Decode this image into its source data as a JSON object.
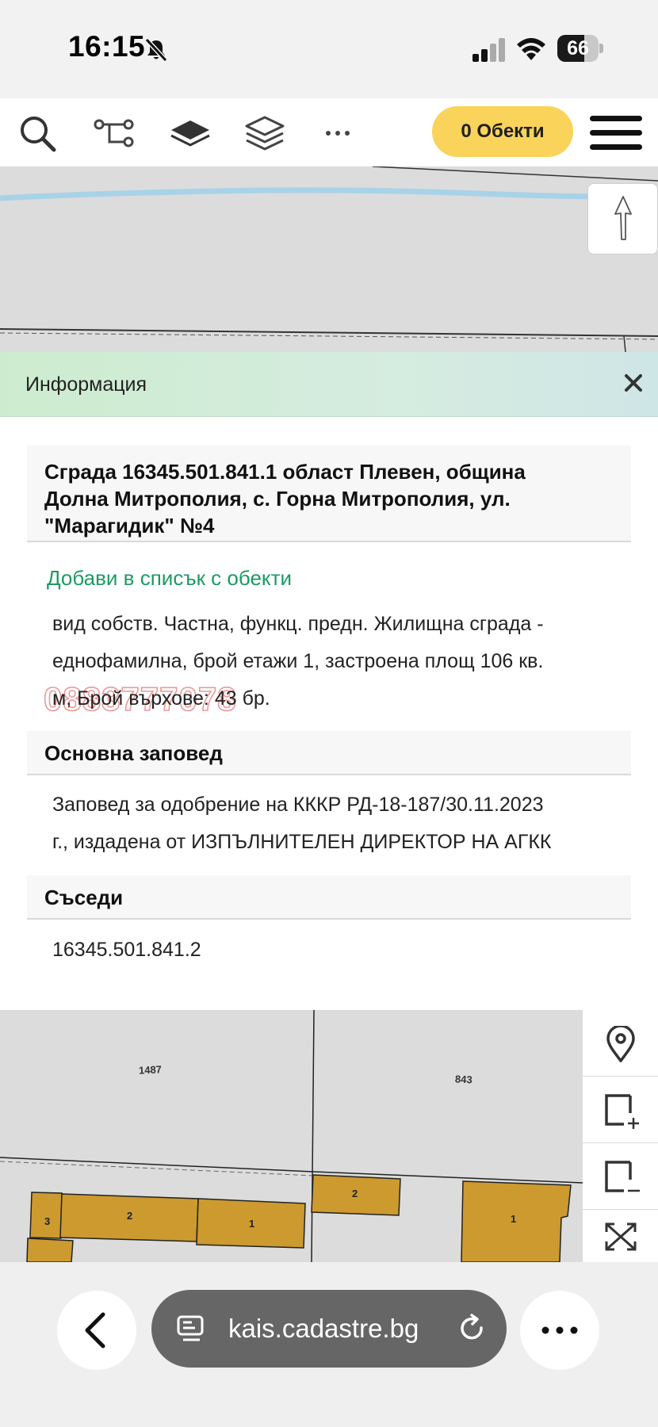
{
  "status_bar": {
    "time": "16:15",
    "battery": "66",
    "battery_level": 0.66,
    "icons": [
      "bell-muted-icon",
      "cellular-signal-icon",
      "wifi-icon",
      "battery-icon"
    ]
  },
  "toolbar": {
    "icons": [
      "search-icon",
      "route-icon",
      "layer-icon",
      "layers-stack-icon",
      "more-dots-icon",
      "hamburger-menu-icon"
    ],
    "objects_button": "0 Обекти"
  },
  "map": {
    "north_arrow_icon": "north-arrow-icon",
    "parcels": [
      "1487",
      "843"
    ],
    "buildings": [
      "3",
      "2",
      "1",
      "2",
      "1"
    ],
    "colors": {
      "building": "#cc9a2e",
      "map_bg": "#dcdcdc",
      "river": "#a8d2e8"
    },
    "controls": [
      "location-pin-icon",
      "select-add-icon",
      "select-remove-icon",
      "fullscreen-icon"
    ]
  },
  "info": {
    "header": "Информация",
    "close_icon": "close-icon",
    "title_lines": [
      "Сграда 16345.501.841.1 област Плевен, община",
      "Долна Митрополия, с. Горна Митрополия, ул.",
      "\"Марагидик\" №4"
    ],
    "add_link": "Добави в списък с обекти",
    "description_lines": [
      "вид собств. Частна, функц. предн. Жилищна сграда -",
      "еднофамилна, брой етажи 1, застроена площ 106 кв.",
      "м, Брой върхове: 43 бр."
    ],
    "watermark": "0883777078",
    "order_heading": "Основна заповед",
    "order_lines": [
      "Заповед за одобрение на КККР РД-18-187/30.11.2023",
      "г., издадена от ИЗПЪЛНИТЕЛЕН ДИРЕКТОР НА АГКК"
    ],
    "neighbors_heading": "Съседи",
    "neighbors": [
      "16345.501.841.2"
    ]
  },
  "browser": {
    "url": "kais.cadastre.bg",
    "icons": [
      "back-chevron-icon",
      "page-tabs-icon",
      "reload-icon",
      "more-horizontal-icon"
    ]
  }
}
